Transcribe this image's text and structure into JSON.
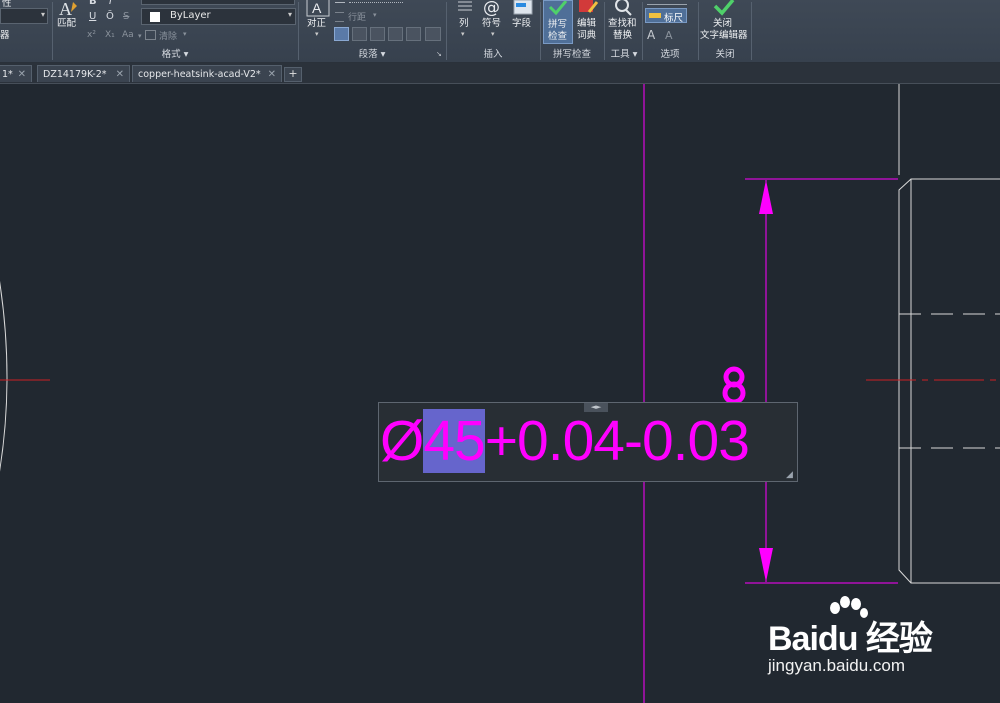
{
  "ribbon": {
    "left_frag1": "性",
    "left_frag2": "器",
    "match_label": "匹配",
    "bold": "B",
    "italic": "I",
    "underline": "U",
    "overline": "Ō",
    "strike": "S",
    "superscript": "x²",
    "subscript": "X₁",
    "case": "Aa",
    "color_value": "ByLayer",
    "clear_label": "清除",
    "justify_label": "对正",
    "line_spacing_label": "行距",
    "column_label": "列",
    "symbol_label": "符号",
    "field_label": "字段",
    "spell_check_label": "拼写\n检查",
    "spell_check_l1": "拼写",
    "spell_check_l2": "检查",
    "edit_dict_l1": "编辑",
    "edit_dict_l2": "词典",
    "find_replace_l1": "查找和",
    "find_replace_l2": "替换",
    "ruler_label": "标尺",
    "close_l1": "关闭",
    "close_l2": "文字编辑器",
    "groups": {
      "format": "格式 ▾",
      "paragraph": "段落 ▾",
      "insert": "插入",
      "spell": "拼写检查",
      "tools": "工具 ▾",
      "options": "选项",
      "close": "关闭"
    }
  },
  "tabs": [
    {
      "label": "1*"
    },
    {
      "label": "DZ14179K-2*"
    },
    {
      "label": "copper-heatsink-acad-V2*"
    }
  ],
  "tab_close": "✕",
  "tab_add": "+",
  "editor": {
    "prefix": "Ø",
    "selected": "45",
    "suffix": "+0.04-0.03",
    "handle": "◄►",
    "resize": "◢"
  },
  "watermark": {
    "brand": "Bai",
    "brand_suffix": "du 经验",
    "url": "jingyan.baidu.com"
  },
  "colors": {
    "dimension": "#ff00ff",
    "centerline": "#cc1f24",
    "geometry": "#d9d9d9",
    "background": "#212830",
    "selection": "#6665cc"
  }
}
